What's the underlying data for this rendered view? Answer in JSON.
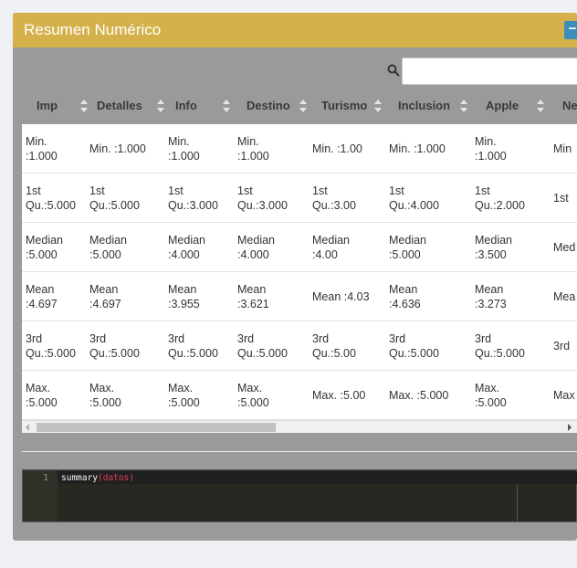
{
  "panel": {
    "title": "Resumen Numérico",
    "collapse_label": "−",
    "accent": "#d4b14a",
    "button_color": "#3c8dbc"
  },
  "search": {
    "value": "",
    "placeholder": ""
  },
  "columns": [
    "Imp",
    "Detalles",
    "Info",
    "Destino",
    "Turismo",
    "Inclusion",
    "Apple",
    "Ne"
  ],
  "rows": [
    [
      "Min.\n:1.000",
      "Min. :1.000",
      "Min.\n:1.000",
      "Min.\n:1.000",
      "Min. :1.00",
      "Min. :1.000",
      "Min.\n:1.000",
      "Min"
    ],
    [
      "1st\nQu.:5.000",
      "1st\nQu.:5.000",
      "1st\nQu.:3.000",
      "1st\nQu.:3.000",
      "1st\nQu.:3.00",
      "1st\nQu.:4.000",
      "1st\nQu.:2.000",
      "1st"
    ],
    [
      "Median\n:5.000",
      "Median\n:5.000",
      "Median\n:4.000",
      "Median\n:4.000",
      "Median\n:4.00",
      "Median\n:5.000",
      "Median\n:3.500",
      "Med"
    ],
    [
      "Mean\n:4.697",
      "Mean\n:4.697",
      "Mean\n:3.955",
      "Mean\n:3.621",
      "Mean :4.03",
      "Mean\n:4.636",
      "Mean\n:3.273",
      "Mea"
    ],
    [
      "3rd\nQu.:5.000",
      "3rd\nQu.:5.000",
      "3rd\nQu.:5.000",
      "3rd\nQu.:5.000",
      "3rd\nQu.:5.00",
      "3rd\nQu.:5.000",
      "3rd\nQu.:5.000",
      "3rd"
    ],
    [
      "Max.\n:5.000",
      "Max.\n:5.000",
      "Max.\n:5.000",
      "Max.\n:5.000",
      "Max. :5.00",
      "Max. :5.000",
      "Max.\n:5.000",
      "Max"
    ]
  ],
  "editor": {
    "line_number": "1",
    "code_fn": "summary",
    "code_open": "(",
    "code_arg": "datos",
    "code_close": ")"
  }
}
